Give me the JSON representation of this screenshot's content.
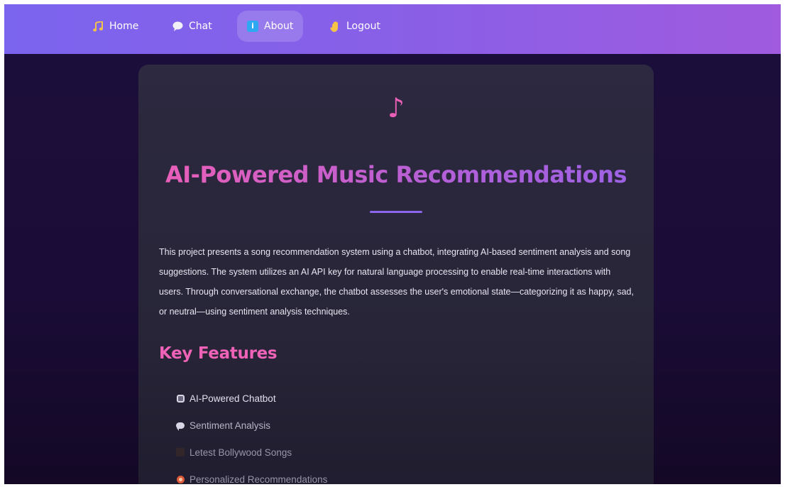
{
  "nav": {
    "items": [
      {
        "label": "Home",
        "icon": "music-notes-icon"
      },
      {
        "label": "Chat",
        "icon": "speech-bubble-icon"
      },
      {
        "label": "About",
        "icon": "info-icon",
        "active": true
      },
      {
        "label": "Logout",
        "icon": "waving-hand-icon"
      }
    ]
  },
  "about": {
    "title": "AI-Powered Music Recommendations",
    "description": "This project presents a song recommendation system using a chatbot, integrating AI-based sentiment analysis and song suggestions. The system utilizes an AI API key for natural language processing to enable real-time interactions with users. Through conversational exchange, the chatbot assesses the user's emotional state—categorizing it as happy, sad, or neutral—using sentiment analysis techniques.",
    "features_heading": "Key Features",
    "features": [
      {
        "label": "AI-Powered Chatbot",
        "icon": "robot-icon"
      },
      {
        "label": "Sentiment Analysis",
        "icon": "speech-bubble-icon"
      },
      {
        "label": "Letest Bollywood Songs",
        "icon": "music-icon"
      },
      {
        "label": "Personalized Recommendations",
        "icon": "target-icon"
      }
    ]
  },
  "colors": {
    "accent_pink": "#ee5fb6",
    "accent_purple": "#8a66ea",
    "nav_gradient_start": "#7b64ee",
    "nav_gradient_end": "#a05bdf",
    "background": "#1d0f3b",
    "card": "#2c2940"
  }
}
